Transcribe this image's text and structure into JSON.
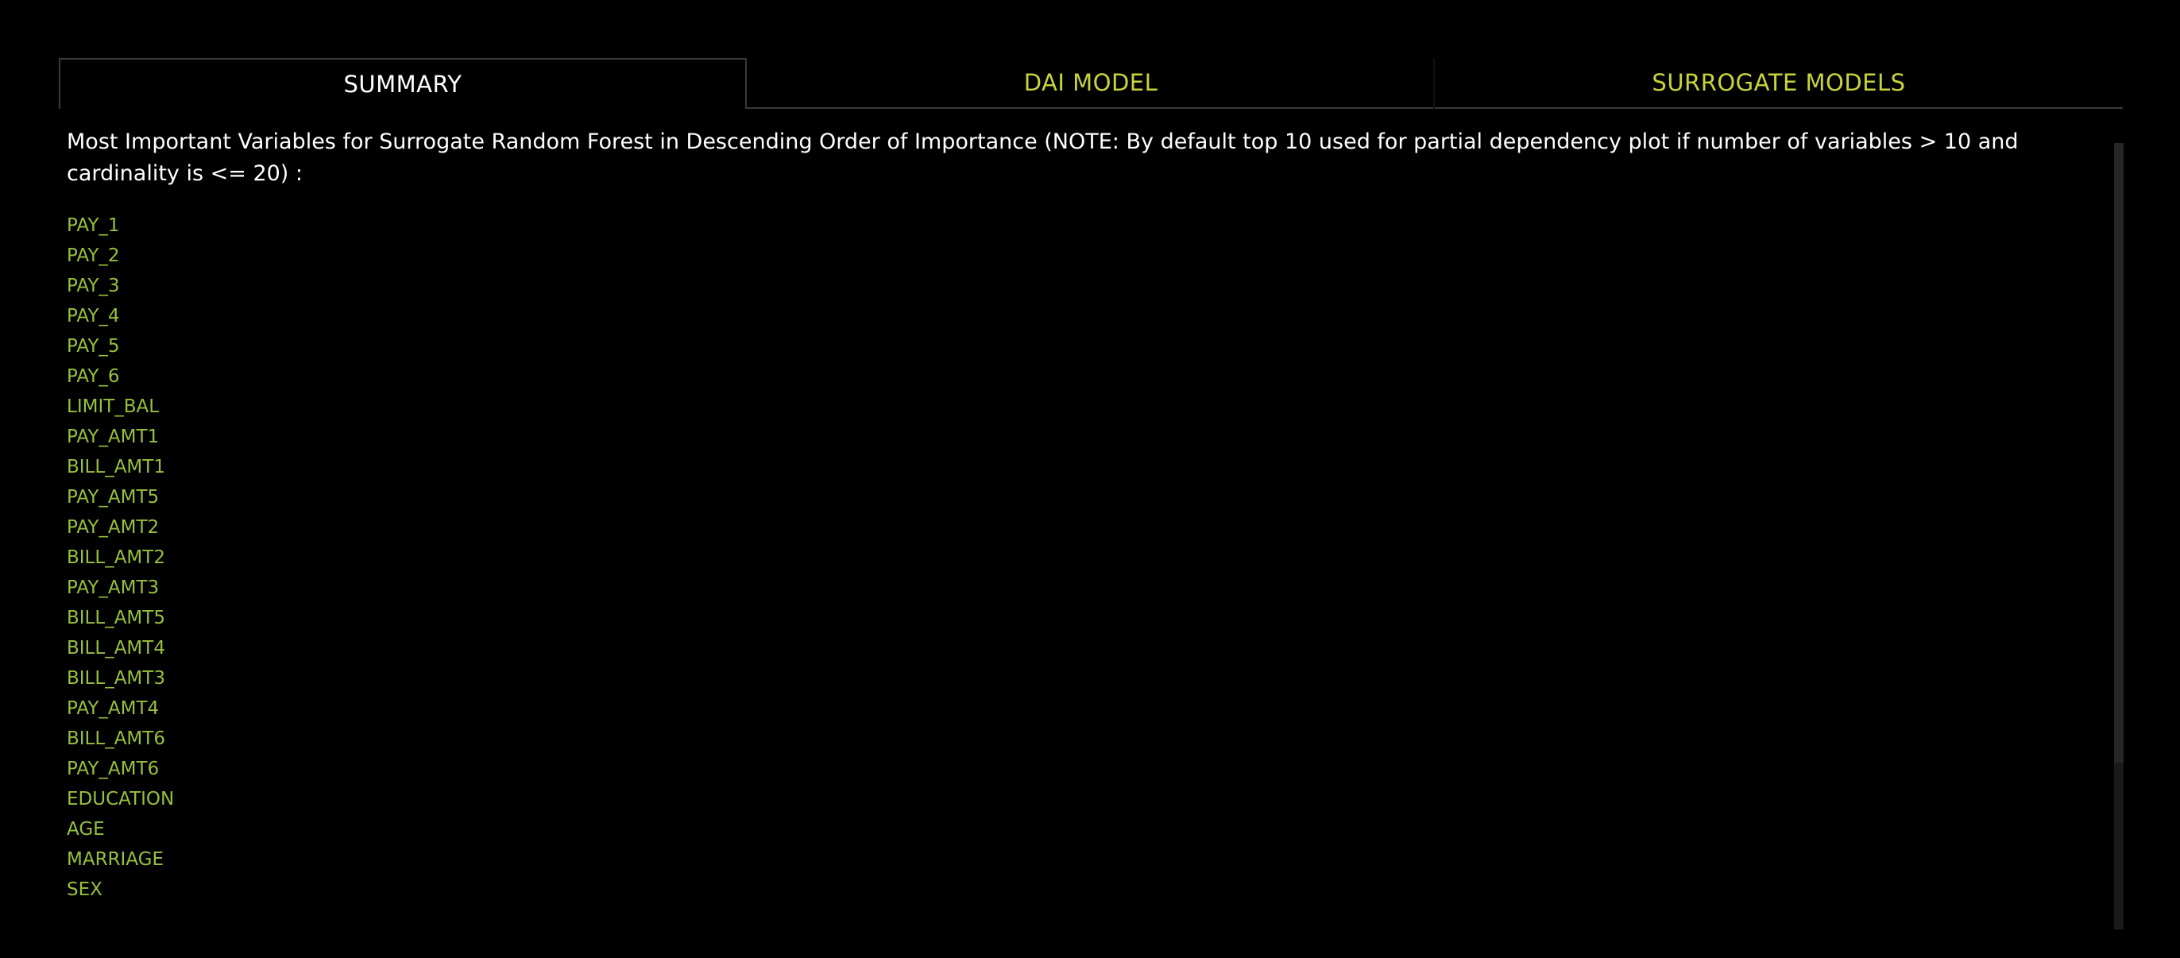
{
  "tabs": [
    {
      "label": "SUMMARY",
      "active": true
    },
    {
      "label": "DAI MODEL",
      "active": false
    },
    {
      "label": "SURROGATE MODELS",
      "active": false
    }
  ],
  "summary": {
    "heading": "Most Important Variables for Surrogate Random Forest in Descending Order of Importance (NOTE: By default top 10 used for partial dependency plot if number of variables > 10 and cardinality is <= 20) :",
    "variables": [
      "PAY_1",
      "PAY_2",
      "PAY_3",
      "PAY_4",
      "PAY_5",
      "PAY_6",
      "LIMIT_BAL",
      "PAY_AMT1",
      "BILL_AMT1",
      "PAY_AMT5",
      "PAY_AMT2",
      "BILL_AMT2",
      "PAY_AMT3",
      "BILL_AMT5",
      "BILL_AMT4",
      "BILL_AMT3",
      "PAY_AMT4",
      "BILL_AMT6",
      "PAY_AMT6",
      "EDUCATION",
      "AGE",
      "MARRIAGE",
      "SEX"
    ]
  },
  "colors": {
    "background": "#000000",
    "active_tab_text": "#ffffff",
    "inactive_tab_text": "#c9d43a",
    "variable_text": "#97c03e"
  }
}
